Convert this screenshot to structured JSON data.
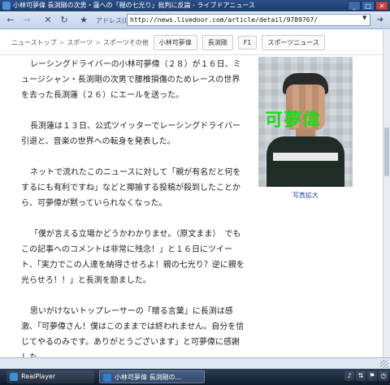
{
  "window": {
    "title": "小林可夢偉 長渕剛の次男・蓮への「親の七光り」批判に反論 - ライブドアニュース",
    "controls": {
      "minimize": "_",
      "maximize": "□",
      "close": "✕"
    }
  },
  "toolbar": {
    "address_label": "アドレス(D)",
    "url": "http://news.livedoor.com/article/detail/9789767/",
    "icons": [
      "back-icon",
      "forward-icon",
      "close-icon",
      "refresh-icon",
      "star-icon",
      "go-icon"
    ]
  },
  "breadcrumb": {
    "items": [
      "ニューストップ",
      "スポーツ",
      "スポーツその他"
    ],
    "separator": ">",
    "tags": [
      "小林可夢偉",
      "長渕剛",
      "F1",
      "スポーツニュース"
    ]
  },
  "article": {
    "paragraphs": [
      "レーシングドライバーの小林可夢偉（２８）が１６日、ミュージシャン・長渕剛の次男で腰椎損傷のためレースの世界を去った長渕蓮（２６）にエールを送った。",
      "長渕蓮は１３日、公式ツイッターでレーシングドライバー引退と、音楽の世界への転身を発表した。",
      "ネットで流れたこのニュースに対して「親が有名だと何をするにも有利ですね」などと揶揄する投稿が殺到したことから、可夢偉が黙っていられなくなった。",
      "「僕が言える立場かどうかわかりませ。（原文まま）　でもこの記事へのコメントは非常に残念！」と１６日にツイート、「実力でこの人達を納得させろよ！親の七光り？逆に親を光らせろ！！」と長渕を励ました。",
      "思いがけないトップレーサーの「贈る言葉」に長渕は感激、「可夢偉さん！僕はこのままでは終われません。自分を信じてやるのみです。ありがとうございます」と可夢偉に感謝した。"
    ]
  },
  "photo": {
    "overlay_text": "可夢偉",
    "caption": "写真拡大"
  },
  "taskbar": {
    "items": [
      "RealPlayer",
      "小林可夢偉 長渕剛の..."
    ],
    "tray_icons": [
      "speaker-icon",
      "network-icon",
      "security-icon",
      "clock-icon"
    ]
  },
  "colors": {
    "titlebar": "#1f3d6c",
    "overlay_green": "#22d81c",
    "link_blue": "#2a4f9c"
  }
}
